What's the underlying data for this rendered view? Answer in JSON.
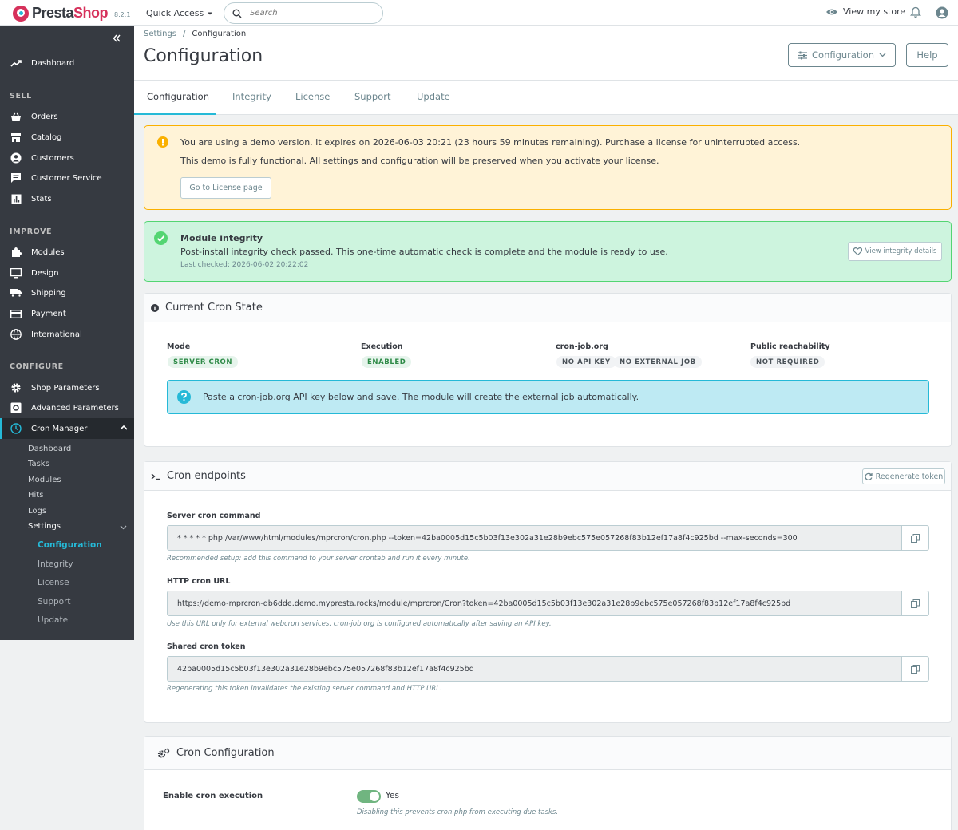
{
  "header": {
    "logo_presta": "Presta",
    "logo_shop": "Shop",
    "version": "8.2.1",
    "quick_access": "Quick Access",
    "search_placeholder": "Search",
    "view_store": "View my store"
  },
  "sidebar": {
    "dashboard": "Dashboard",
    "sections": {
      "sell": "SELL",
      "improve": "IMPROVE",
      "configure": "CONFIGURE"
    },
    "sell_items": [
      "Orders",
      "Catalog",
      "Customers",
      "Customer Service",
      "Stats"
    ],
    "improve_items": [
      "Modules",
      "Design",
      "Shipping",
      "Payment",
      "International"
    ],
    "configure_items": [
      "Shop Parameters",
      "Advanced Parameters",
      "Cron Manager"
    ],
    "cron_sub": [
      "Dashboard",
      "Tasks",
      "Modules",
      "Hits",
      "Logs",
      "Settings"
    ],
    "settings_sub": [
      "Configuration",
      "Integrity",
      "License",
      "Support",
      "Update"
    ]
  },
  "toolbar": {
    "breadcrumb_parent": "Settings",
    "breadcrumb_sep": "/",
    "breadcrumb_current": "Configuration",
    "title": "Configuration",
    "config_button": "Configuration",
    "help_button": "Help"
  },
  "tabs": [
    "Configuration",
    "Integrity",
    "License",
    "Support",
    "Update"
  ],
  "demo_alert": {
    "line1": "You are using a demo version. It expires on 2026-06-03 20:21 (23 hours 59 minutes remaining). Purchase a license for uninterrupted access.",
    "line2": "This demo is fully functional. All settings and configuration will be preserved when you activate your license.",
    "button": "Go to License page"
  },
  "integrity_alert": {
    "title": "Module integrity",
    "message": "Post-install integrity check passed. This one-time automatic check is complete and the module is ready to use.",
    "last_checked": "Last checked: 2026-06-02 20:22:02",
    "button": "View integrity details"
  },
  "cron_state": {
    "title": "Current Cron State",
    "mode_label": "Mode",
    "mode_value": "SERVER CRON",
    "execution_label": "Execution",
    "execution_value": "ENABLED",
    "cronjob_label": "cron-job.org",
    "cronjob_values": [
      "NO API KEY",
      "NO EXTERNAL JOB"
    ],
    "reach_label": "Public reachability",
    "reach_value": "NOT REQUIRED",
    "info": "Paste a cron-job.org API key below and save. The module will create the external job automatically."
  },
  "endpoints": {
    "title": "Cron endpoints",
    "regen_button": "Regenerate token",
    "server_label": "Server cron command",
    "server_value": "* * * * * php /var/www/html/modules/mprcron/cron.php --token=42ba0005d15c5b03f13e302a31e28b9ebc575e057268f83b12ef17a8f4c925bd --max-seconds=300",
    "server_help": "Recommended setup: add this command to your server crontab and run it every minute.",
    "http_label": "HTTP cron URL",
    "http_value": "https://demo-mprcron-db6dde.demo.mypresta.rocks/module/mprcron/Cron?token=42ba0005d15c5b03f13e302a31e28b9ebc575e057268f83b12ef17a8f4c925bd",
    "http_help": "Use this URL only for external webcron services. cron-job.org is configured automatically after saving an API key.",
    "token_label": "Shared cron token",
    "token_value": "42ba0005d15c5b03f13e302a31e28b9ebc575e057268f83b12ef17a8f4c925bd",
    "token_help": "Regenerating this token invalidates the existing server command and HTTP URL."
  },
  "config": {
    "title": "Cron Configuration",
    "enable_label": "Enable cron execution",
    "toggle_state": "Yes",
    "enable_help": "Disabling this prevents cron.php from executing due tasks."
  },
  "colors": {
    "brand": "#d6315b",
    "accent": "#25b9d7",
    "sidebar": "#363a41",
    "success": "#53d572",
    "warning": "#fab000"
  }
}
